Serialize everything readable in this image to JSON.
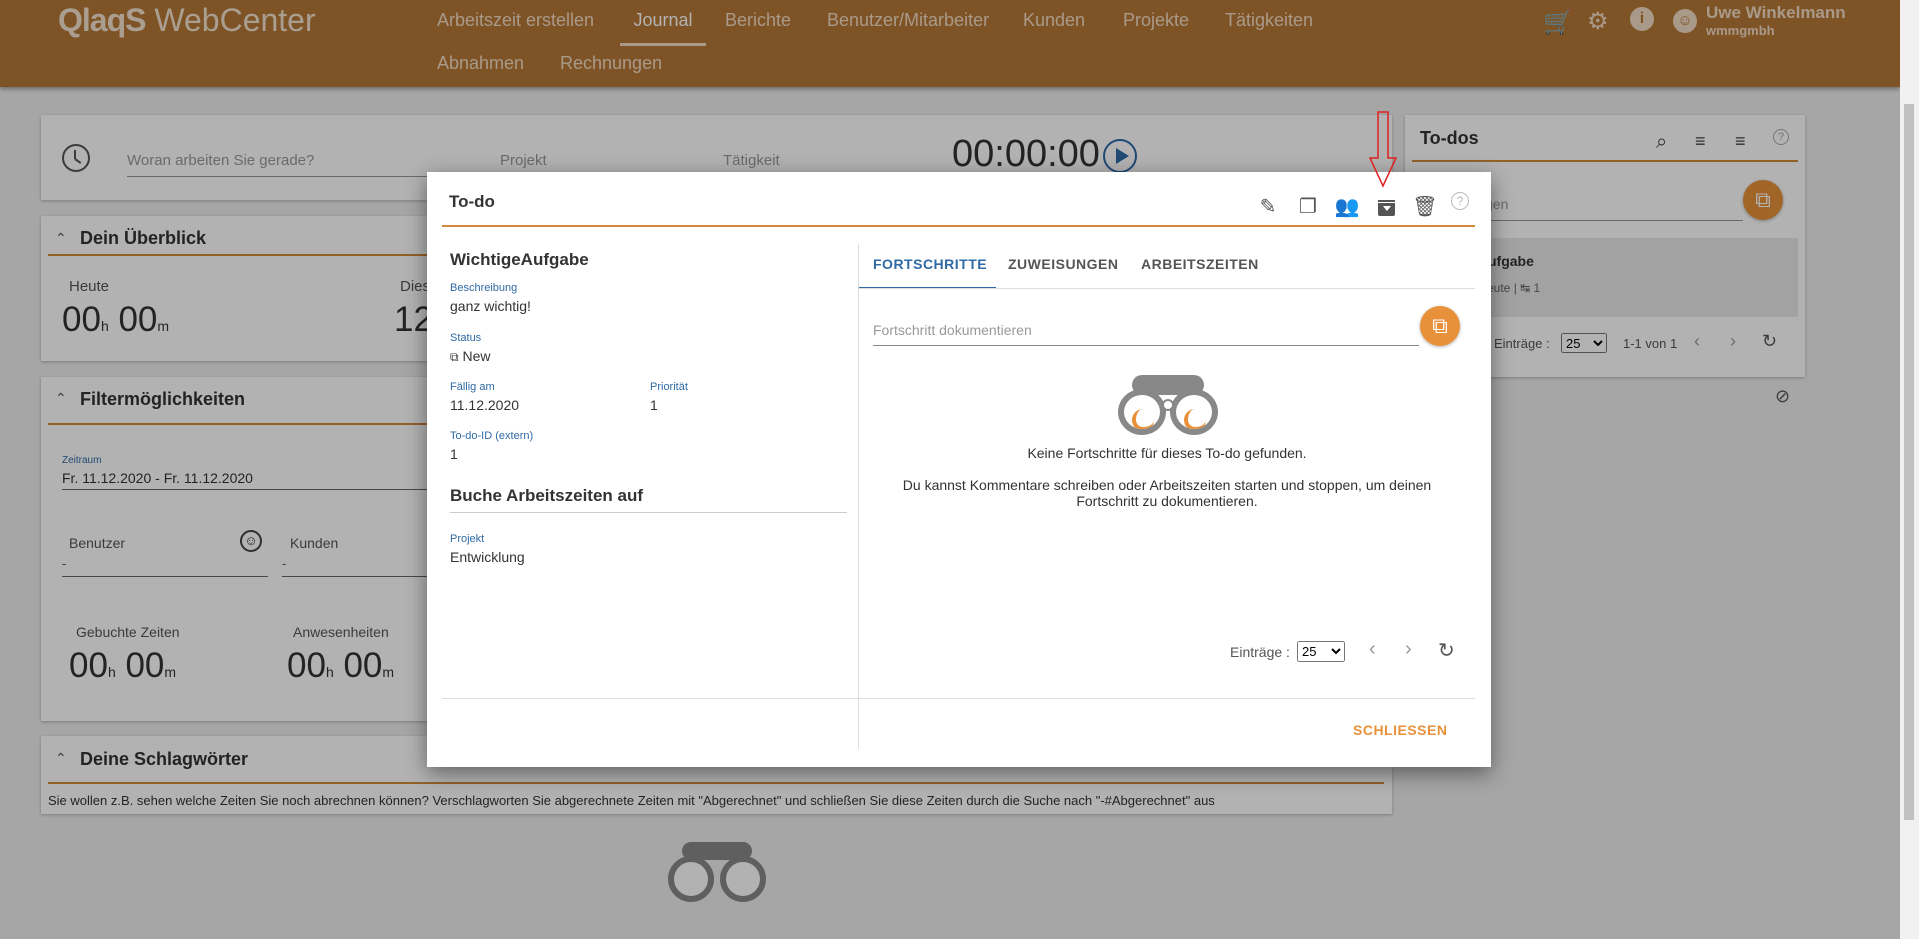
{
  "app": {
    "logo_brand": "QlaqS",
    "logo_product": "WebCenter"
  },
  "nav": [
    "Arbeitszeit erstellen",
    "Journal",
    "Berichte",
    "Benutzer/Mitarbeiter",
    "Kunden",
    "Projekte",
    "Tätigkeiten",
    "Abnahmen",
    "Rechnungen"
  ],
  "user": {
    "name": "Uwe Winkelmann",
    "company": "wmmgmbh"
  },
  "timer": {
    "placeholder": "Woran arbeiten Sie gerade?",
    "projekt": "Projekt",
    "taetigkeit": "Tätigkeit",
    "time": "00:00:00"
  },
  "overview": {
    "title": "Dein Überblick",
    "heute": "Heute",
    "heute_h": "00",
    "heute_m": "00",
    "dies": "Dies",
    "dies_val": "12",
    "h": "h",
    "m": "m"
  },
  "filter": {
    "title": "Filtermöglichkeiten",
    "zeitraum_label": "Zeitraum",
    "zeitraum": "Fr. 11.12.2020 - Fr. 11.12.2020",
    "benutzer": "Benutzer",
    "benutzer_val": "-",
    "kunden": "Kunden",
    "kunden_val": "-",
    "gebuchte": "Gebuchte Zeiten",
    "gebuchte_h": "00",
    "gebuchte_m": "00",
    "anwesenheiten": "Anwesenheiten",
    "anw_h": "00",
    "anw_m": "00"
  },
  "tags": {
    "title": "Deine Schlagwörter",
    "text": "Sie wollen z.B. sehen welche Zeiten Sie noch abrechnen können? Verschlagworten Sie abgerechnete Zeiten mit \"Abgerechnet\" und schließen Sie diese Zeiten durch die Suche nach \"-#Abgerechnet\" aus"
  },
  "todos": {
    "title": "To-dos",
    "search_partial": "gen",
    "item_title_partial": "ufgabe",
    "item_meta_partial": "eute | ↹ 1",
    "eintraege_label": "Einträge :",
    "eintraege": "25",
    "range": "1-1 von 1"
  },
  "modal": {
    "title": "To-do",
    "name": "WichtigeAufgabe",
    "beschreibung_label": "Beschreibung",
    "beschreibung": "ganz wichtig!",
    "status_label": "Status",
    "status": "New",
    "faellig_label": "Fällig am",
    "faellig": "11.12.2020",
    "prioritaet_label": "Priorität",
    "prioritaet": "1",
    "todo_id_label": "To-do-ID (extern)",
    "todo_id": "1",
    "buche_title": "Buche Arbeitszeiten auf",
    "projekt_label": "Projekt",
    "projekt": "Entwicklung",
    "tabs": [
      "FORTSCHRITTE",
      "ZUWEISUNGEN",
      "ARBEITSZEITEN"
    ],
    "fortschritt_placeholder": "Fortschritt dokumentieren",
    "empty_title": "Keine Fortschritte für dieses To-do gefunden.",
    "empty_text_1": "Du kannst Kommentare schreiben oder Arbeitszeiten starten und stoppen, um deinen",
    "empty_text_2": "Fortschritt zu dokumentieren.",
    "eintraege_label": "Einträge :",
    "eintraege": "25",
    "close": "SCHLIESSEN"
  },
  "colors": {
    "header": "#b57836",
    "accent": "#e8913a",
    "link": "#2f6aa5",
    "arrow": "#e02020"
  }
}
